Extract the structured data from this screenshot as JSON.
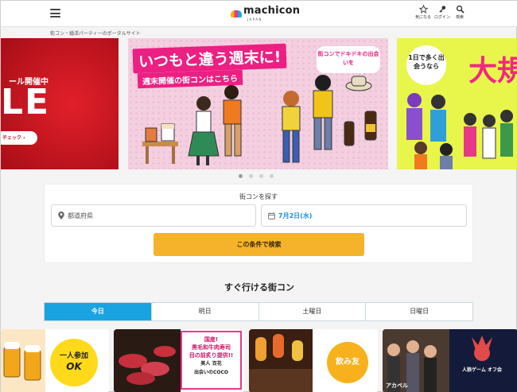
{
  "header": {
    "logo_text": "machicon",
    "logo_sub": "JAPAN",
    "favorites_label": "気になる",
    "login_label": "ログイン",
    "search_label": "検索"
  },
  "breadcrumb": "街コン・婚活パーティーのポータルサイト",
  "carousel": {
    "slide_left": {
      "headline": "ール開催中",
      "big": "LE",
      "button": "チェック"
    },
    "slide_mid": {
      "title": "いつもと違う週末に!",
      "subtitle": "週末開催の街コンはこちら",
      "bubble": "街コンでドキドキの出会いを"
    },
    "slide_right": {
      "circle": "1日で多く出会うなら",
      "big": "大規パー"
    },
    "dots": 4,
    "active_dot": 0
  },
  "search": {
    "title": "街コンを探す",
    "prefecture_placeholder": "都道府県",
    "date_value": "7月2日(水)",
    "button_label": "この条件で検索"
  },
  "soon": {
    "title": "すぐ行ける街コン",
    "tabs": [
      {
        "label": "今日",
        "active": true
      },
      {
        "label": "明日",
        "active": false
      },
      {
        "label": "土曜日",
        "active": false
      },
      {
        "label": "日曜日",
        "active": false
      }
    ]
  },
  "cards": {
    "card_a": {
      "line1": "一人参加",
      "line2": "OK"
    },
    "card_b": {
      "line1": "国産!",
      "line2": "黒毛和牛肉寿司",
      "line3": "目の前炙り提供!!",
      "line4": "美人",
      "line5": "百花",
      "line6": "出会いのCOCO"
    },
    "card_c": {
      "label": "飲み友"
    },
    "card_d": {
      "label": "人狼ゲーム オフ会",
      "sub": "アカペル"
    }
  },
  "colors": {
    "accent_blue": "#1aa3e1",
    "search_button": "#f5b32c",
    "pink": "#ec1f82"
  }
}
